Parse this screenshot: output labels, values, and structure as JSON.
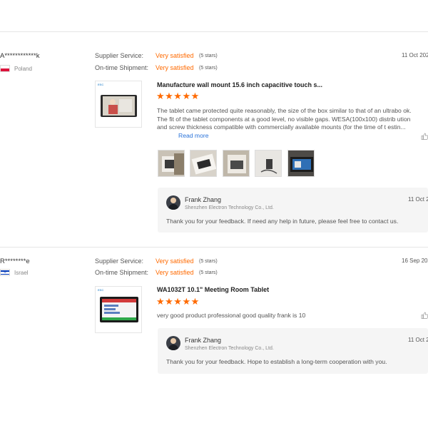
{
  "reviews": [
    {
      "buyer_name": "A************k",
      "country": "Poland",
      "supplier_service_label": "Supplier Service:",
      "supplier_service_value": "Very satisfied",
      "supplier_service_stars": "(5 stars)",
      "shipment_label": "On-time Shipment:",
      "shipment_value": "Very satisfied",
      "shipment_stars": "(5 stars)",
      "date": "11 Oct 202",
      "product_brand": "ESC",
      "product_title": "Manufacture wall mount 15.6 inch capacitive touch s...",
      "rating_stars": "★★★★★",
      "review_text": "The tablet came protected quite reasonably, the size of the box similar to that of an ultrabo ok. The fit of the tablet components at a good level, no visible gaps. WESA(100x100) distrib ution and screw thickness compatible with commercially available mounts (for the time of t estin...",
      "read_more": "Read more",
      "reply": {
        "name": "Frank Zhang",
        "company": "Shenzhen Electron Technology Co., Ltd.",
        "date": "11 Oct 2",
        "text": "Thank you for your feedback. If need any help in future, please feel free to contact us."
      }
    },
    {
      "buyer_name": "R********e",
      "country": "Israel",
      "supplier_service_label": "Supplier Service:",
      "supplier_service_value": "Very satisfied",
      "supplier_service_stars": "(5 stars)",
      "shipment_label": "On-time Shipment:",
      "shipment_value": "Very satisfied",
      "shipment_stars": "(5 stars)",
      "date": "16 Sep 202",
      "product_brand": "ESC",
      "product_title": "WA1032T 10.1\" Meeting Room Tablet",
      "rating_stars": "★★★★★",
      "review_text": "very good product professional good quality frank is 10",
      "reply": {
        "name": "Frank Zhang",
        "company": "Shenzhen Electron Technology Co., Ltd.",
        "date": "11 Oct 2",
        "text": "Thank you for your feedback. Hope to establish a long-term cooperation with you."
      }
    }
  ],
  "colors": {
    "accent": "#ff6a00",
    "link": "#2a73d9",
    "reply_bg": "#f5f5f5"
  },
  "icons": [
    "flag-poland-icon",
    "flag-israel-icon",
    "like-icon",
    "avatar"
  ]
}
